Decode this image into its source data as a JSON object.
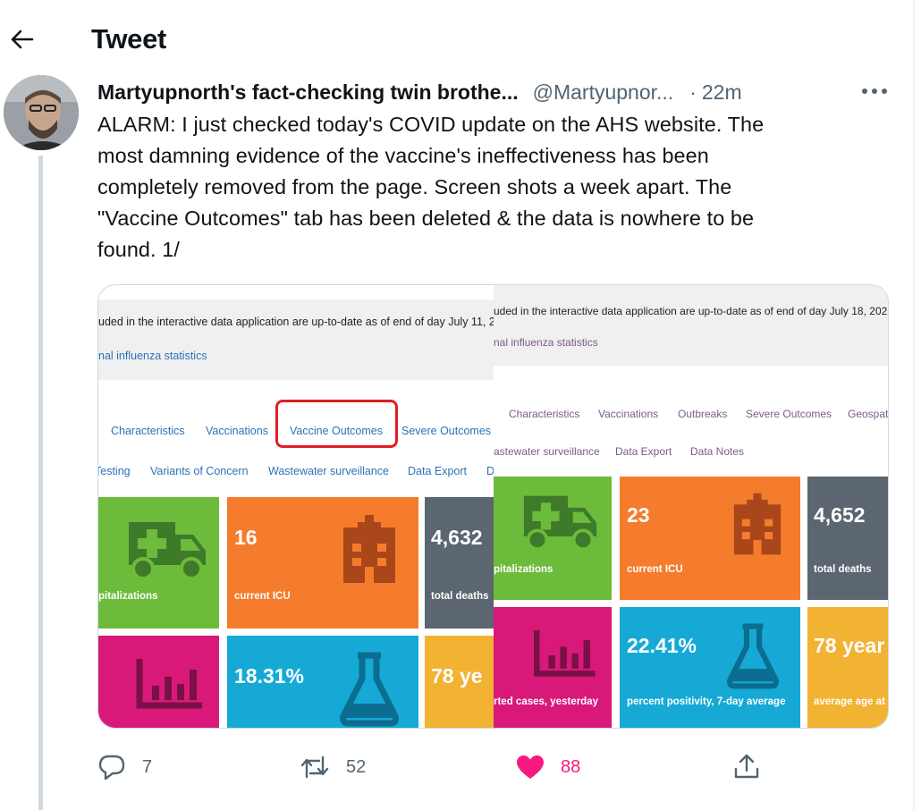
{
  "header": {
    "title": "Tweet"
  },
  "tweet": {
    "author_name": "Martyupnorth's fact-checking twin brothe...",
    "author_handle": "@Martyupnor...",
    "separator": "·",
    "timestamp": "22m",
    "text_lines": [
      "ALARM: I just checked today's COVID update on the AHS website. The",
      "most damning evidence of the vaccine's ineffectiveness has been",
      "completely removed from the page. Screen shots a week apart. The",
      "\"Vaccine Outcomes\" tab has been deleted & the data is nowhere to be",
      "found. 1/"
    ]
  },
  "media": {
    "left": {
      "notice": "uded in the interactive data application are up-to-date as of end of day July 11, 202",
      "flu_link": "nal influenza statistics",
      "tabs_row1": [
        "Characteristics",
        "Vaccinations",
        "Vaccine Outcomes",
        "Severe Outcomes"
      ],
      "tabs_row2": [
        "Testing",
        "Variants of Concern",
        "Wastewater surveillance",
        "Data Export",
        "D"
      ],
      "tiles": {
        "hosp_label": "pitalizations",
        "icu_value": "16",
        "icu_label": "current ICU",
        "deaths_value": "4,632",
        "deaths_label": "total deaths",
        "positivity_value": "18.31%",
        "age_value": "78 ye"
      }
    },
    "right": {
      "notice": "uded in the interactive data application are up-to-date as of end of day July 18, 2022, u",
      "flu_link": "nal influenza statistics",
      "tabs_row1": [
        "Characteristics",
        "Vaccinations",
        "Outbreaks",
        "Severe Outcomes",
        "Geospat"
      ],
      "tabs_row2": [
        "astewater surveillance",
        "Data Export",
        "Data Notes"
      ],
      "tiles": {
        "hosp_label": "pitalizations",
        "icu_value": "23",
        "icu_label": "current ICU",
        "deaths_value": "4,652",
        "deaths_label": "total deaths",
        "cases_label": "rted cases, yesterday",
        "positivity_value": "22.41%",
        "positivity_label": "percent positivity, 7-day average",
        "age_value": "78 year",
        "age_label": "average age at"
      }
    }
  },
  "actions": {
    "replies": "7",
    "retweets": "52",
    "likes": "88"
  },
  "colors": {
    "green": "#6dbb3a",
    "orange": "#f47c2c",
    "slate": "#5b6670",
    "magenta": "#d8197a",
    "cyan": "#16a9d6",
    "yellow": "#f2b232",
    "like_pink": "#f91880",
    "highlight_red": "#e11e24"
  }
}
